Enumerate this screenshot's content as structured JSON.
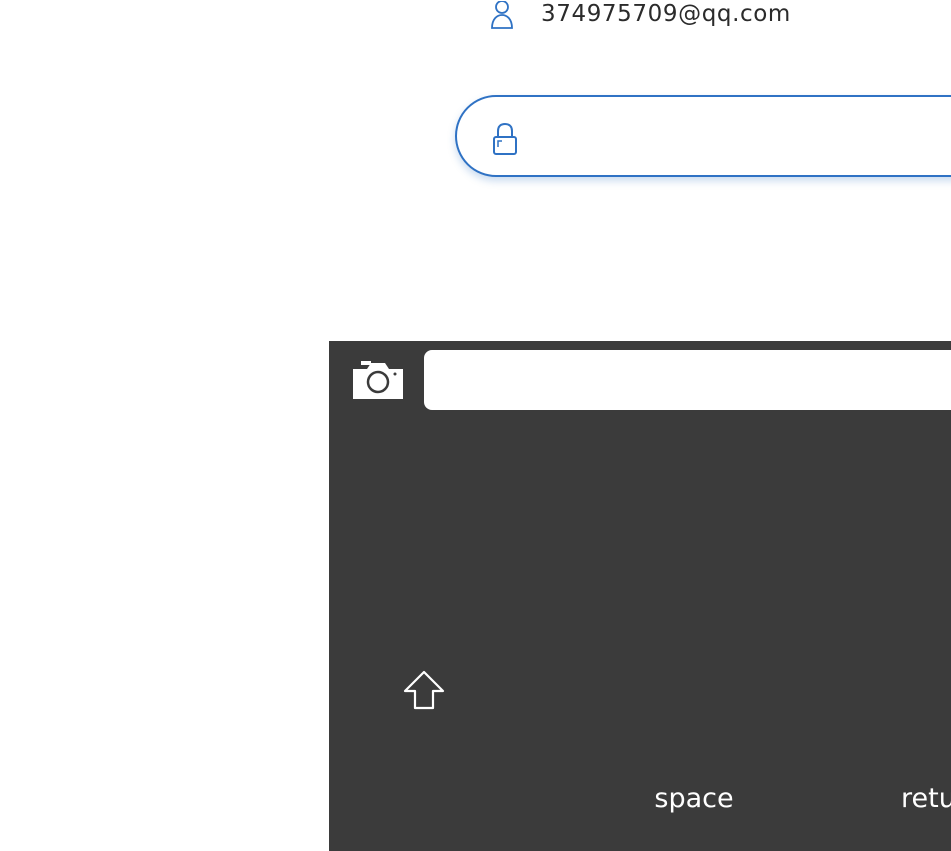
{
  "login": {
    "email": "374975709@qq.com",
    "password_value": "",
    "accent_color": "#2f72c4"
  },
  "keyboard": {
    "input_value": "",
    "space_label": "space",
    "return_label": "return",
    "background_color": "#3b3b3b",
    "icons": {
      "camera": "camera-icon",
      "shift": "shift-arrow-icon"
    }
  }
}
